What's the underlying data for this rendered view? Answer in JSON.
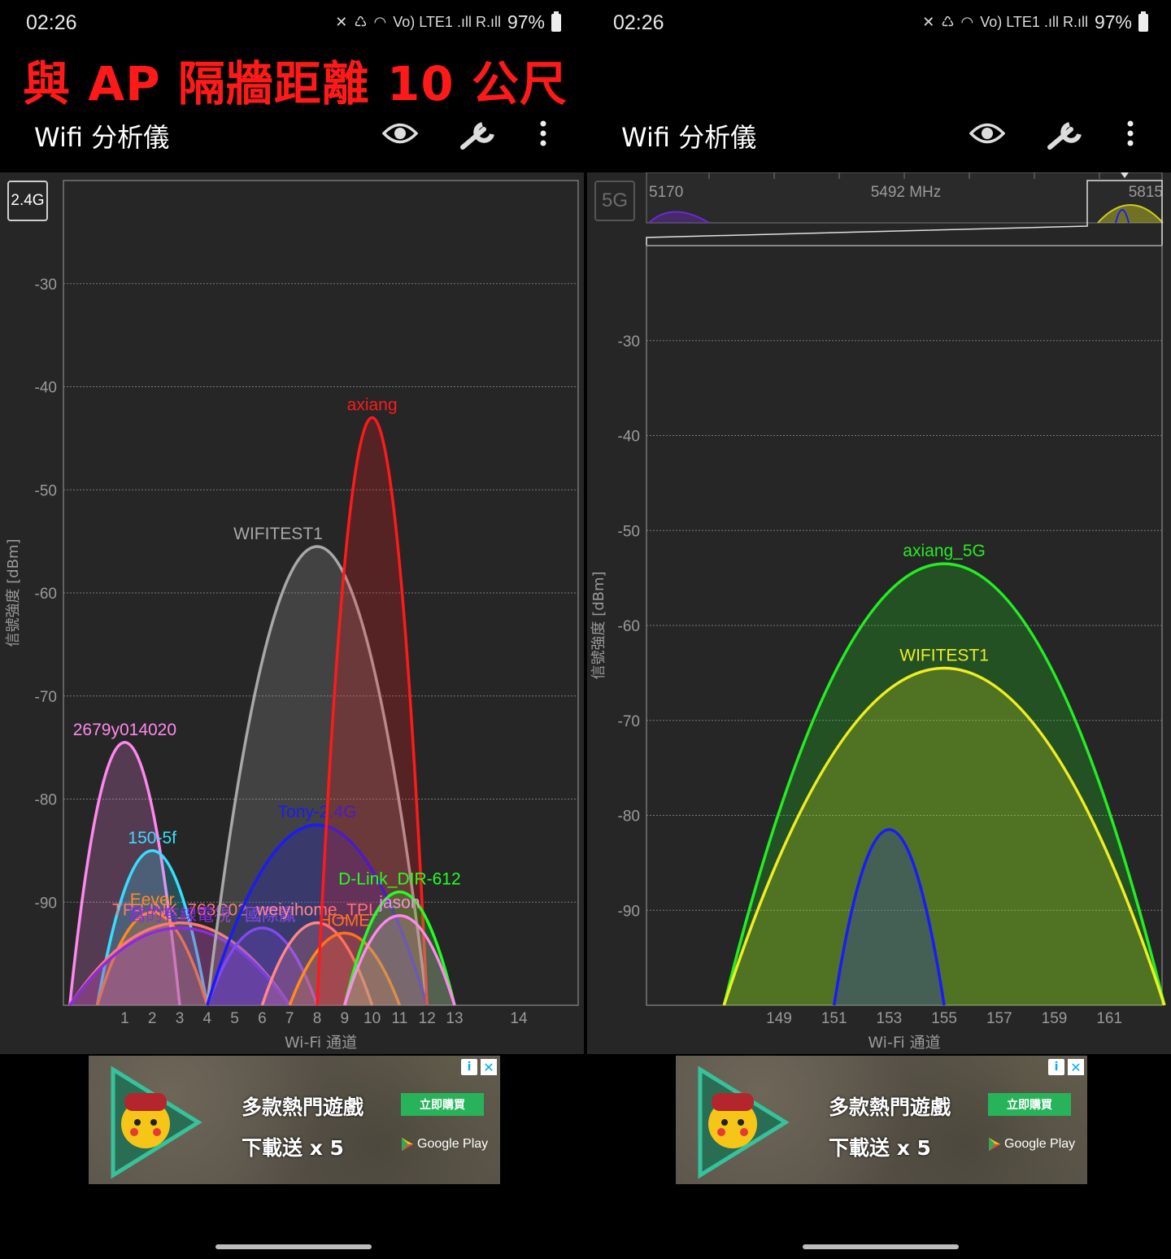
{
  "overlay_title": "與 AP 隔牆距離 10 公尺",
  "status": {
    "time": "02:26",
    "battery": "97%",
    "signal_glyphs": "Vo) LTE1 .ıll R.ıll"
  },
  "app": {
    "title": "Wifi 分析儀"
  },
  "axis_labels": {
    "y": "信號強度 [dBm]",
    "x": "Wi-Fi 通道"
  },
  "ad": {
    "line1": "多款熱門遊戲",
    "line2": "下載送 x 5",
    "button": "立即購買",
    "store": "Google Play",
    "info": "i",
    "close": "✕"
  },
  "left_screen": {
    "band": "2.4G",
    "chart_data": {
      "type": "area",
      "xlabel": "Wi-Fi 通道",
      "ylabel": "信號強度 [dBm]",
      "ylim": [
        -100,
        -20
      ],
      "yticks": [
        -30,
        -40,
        -50,
        -60,
        -70,
        -80,
        -90
      ],
      "xticks": [
        "1",
        "2",
        "3",
        "4",
        "5",
        "6",
        "7",
        "8",
        "9",
        "10",
        "11",
        "12",
        "13",
        "14"
      ],
      "grid": true,
      "series": [
        {
          "name": "2679y014020",
          "channel": 1,
          "width": 20,
          "peak": -74.5,
          "color": "#ff88ee",
          "label_dx": 0
        },
        {
          "name": "150-5f",
          "channel": 2,
          "width": 20,
          "peak": -85,
          "color": "#33e0ff",
          "label_dx": 0
        },
        {
          "name": "Eever",
          "channel": 2,
          "width": 20,
          "peak": -91,
          "color": "#ff8c1a",
          "label_dx": 0
        },
        {
          "name": "TP-LINK_763C02",
          "channel": 3,
          "width": 40,
          "peak": -92,
          "color": "#ff7777",
          "label_dx": 0
        },
        {
          "name": "窩的有線電視",
          "channel": 3,
          "width": 40,
          "peak": -92.5,
          "color": "#8a2be2",
          "label_dx": 0
        },
        {
          "name": "國際贏",
          "channel": 6,
          "width": 20,
          "peak": -92.5,
          "color": "#9b40ff",
          "label_dx": 10
        },
        {
          "name": "WIFITEST1",
          "channel": 8,
          "width": 40,
          "peak": -55.5,
          "color": "#a8a8a8",
          "label_dx": -48
        },
        {
          "name": "Tony-2.4G",
          "channel": 8,
          "width": 40,
          "peak": -82.5,
          "color": "#1a1aff",
          "label_dx": 0
        },
        {
          "name": "weiyihome_TPL",
          "channel": 8,
          "width": 20,
          "peak": -92,
          "color": "#ff8888",
          "label_dx": 0
        },
        {
          "name": "HOME",
          "channel": 9,
          "width": 20,
          "peak": -93,
          "color": "#ff8c1a",
          "label_dx": 0
        },
        {
          "name": "axiang",
          "channel": 10,
          "width": 20,
          "peak": -43,
          "color": "#ff1a1a",
          "label_dx": 0
        },
        {
          "name": "D-Link_DIR-612",
          "channel": 11,
          "width": 20,
          "peak": -89,
          "color": "#22ff22",
          "label_dx": 0
        },
        {
          "name": "jason",
          "channel": 11,
          "width": 20,
          "peak": -91.3,
          "color": "#ff88ee",
          "label_dx": 0
        }
      ]
    }
  },
  "right_screen": {
    "band": "5G",
    "nav": {
      "start": "5170",
      "mid": "5492 MHz",
      "end": "5815"
    },
    "chart_data": {
      "type": "area",
      "xlabel": "Wi-Fi 通道",
      "ylabel": "信號強度 [dBm]",
      "ylim": [
        -100,
        -20
      ],
      "yticks": [
        -30,
        -40,
        -50,
        -60,
        -70,
        -80,
        -90
      ],
      "xticks": [
        "149",
        "151",
        "153",
        "155",
        "157",
        "159",
        "161"
      ],
      "grid": true,
      "series": [
        {
          "name": "axiang_5G",
          "channel": 155,
          "width": 80,
          "peak": -53.5,
          "color": "#22ee22",
          "show_label": true
        },
        {
          "name": "WIFITEST1",
          "channel": 155,
          "width": 80,
          "peak": -64.5,
          "color": "#eeee22",
          "show_label": true
        },
        {
          "name": "",
          "channel": 153,
          "width": 20,
          "peak": -81.5,
          "color": "#1a1aff",
          "show_label": false
        }
      ]
    }
  }
}
